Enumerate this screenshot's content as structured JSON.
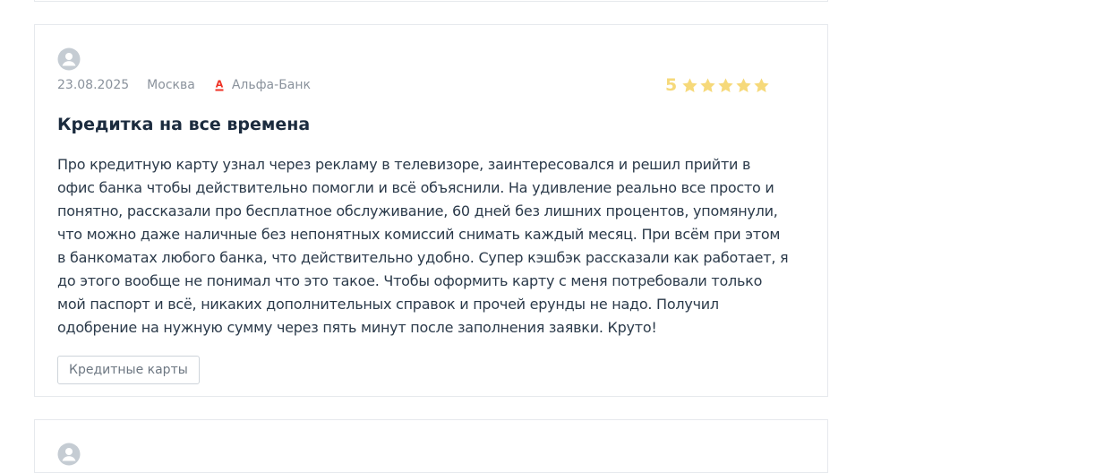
{
  "review": {
    "date": "23.08.2025",
    "city": "Москва",
    "bank": "Альфа-Банк",
    "bank_logo_letter": "А",
    "rating": "5",
    "stars_filled": 5,
    "stars_total": 5,
    "title": "Кредитка на все времена",
    "body_lines": [
      "Про кредитную карту узнал через рекламу в телевизоре, заинтересовался и решил прийти в",
      "офис банка чтобы действительно помогли и всё объяснили. На удивление реально все просто и",
      "понятно, рассказали про бесплатное обслуживание, 60 дней без лишних процентов, упомянули,",
      "что можно даже наличные без непонятных комиссий снимать каждый месяц. При всём при этом",
      "в банкоматах любого банка, что действительно удобно. Супер кэшбэк рассказали как работает, я",
      "до этого вообще не понимал что это такое. Чтобы оформить карту с меня потребовали только",
      "мой паспорт и всё, никаких дополнительных справок и прочей ерунды не надо. Получил",
      "одобрение на нужную сумму через пять минут после заполнения заявки. Круто!"
    ],
    "tag": "Кредитные карты"
  },
  "icons": {
    "avatar": "user-avatar-icon",
    "bank_logo": "alfa-bank-logo",
    "star": "star-icon"
  },
  "colors": {
    "star": "#f6d97a",
    "bank_logo": "#ef3124",
    "avatar": "#c5ccd3"
  }
}
